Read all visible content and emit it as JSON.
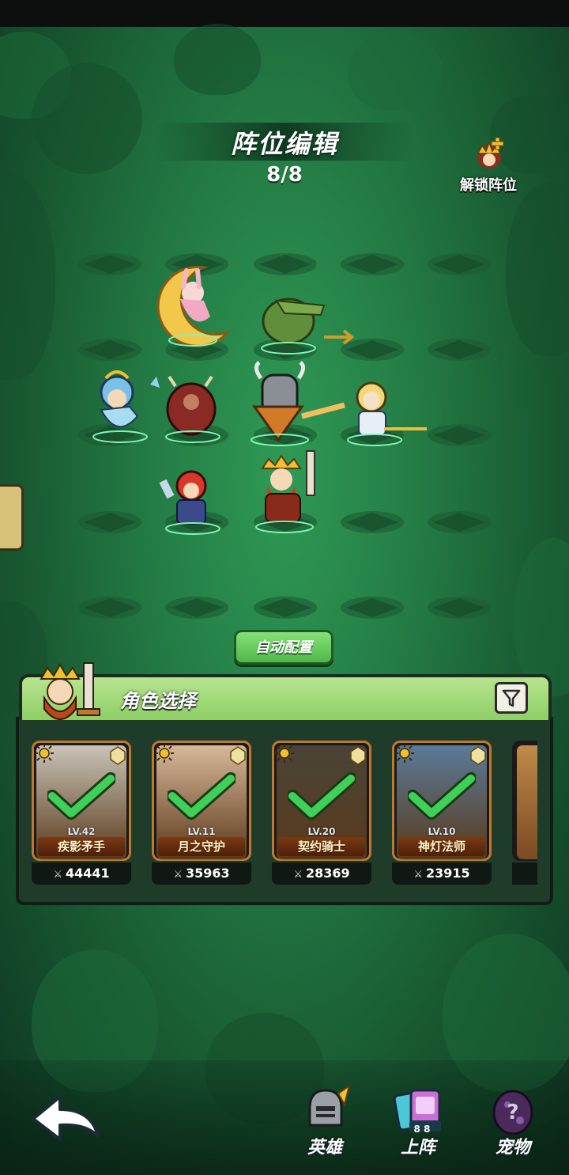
{
  "header": {
    "title": "阵位编辑",
    "slot_count": "8/8",
    "unlock_label": "解锁阵位"
  },
  "formation": {
    "auto_button_label": "自动配置"
  },
  "character_panel": {
    "title": "角色选择",
    "cards": [
      {
        "level": "LV.42",
        "name": "疾影矛手",
        "power": "44441",
        "selected": true,
        "art_color": "#c9c4b8"
      },
      {
        "level": "LV.11",
        "name": "月之守护",
        "power": "35963",
        "selected": true,
        "art_color": "#d8b89a"
      },
      {
        "level": "LV.20",
        "name": "契约骑士",
        "power": "28369",
        "selected": true,
        "art_color": "#4a4438"
      },
      {
        "level": "LV.10",
        "name": "神灯法师",
        "power": "23915",
        "selected": true,
        "art_color": "#5a7a9a"
      }
    ]
  },
  "bottom_nav": {
    "items": [
      {
        "label": "英雄"
      },
      {
        "label": "上阵",
        "badge": "8 8"
      },
      {
        "label": "宠物"
      }
    ]
  },
  "colors": {
    "accent_green": "#4fb848",
    "check_green": "#3fd05a",
    "card_frame": "#c0782c"
  }
}
